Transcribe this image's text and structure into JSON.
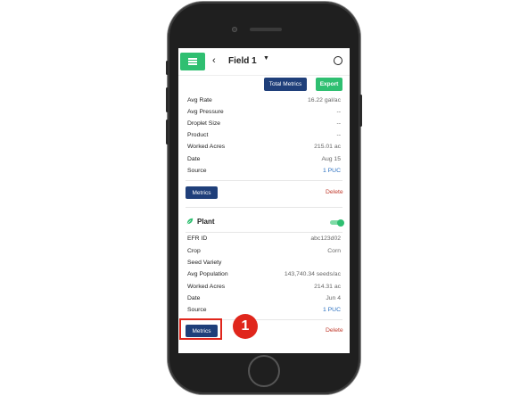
{
  "header": {
    "back_glyph": "‹",
    "field_title": "Field 1",
    "caret_glyph": "▼"
  },
  "toolbar": {
    "total_metrics_label": "Total Metrics",
    "export_label": "Export"
  },
  "first_record": {
    "rows": [
      {
        "label": "Avg Rate",
        "value": "16.22 gal/ac"
      },
      {
        "label": "Avg Pressure",
        "value": "--"
      },
      {
        "label": "Droplet Size",
        "value": "--"
      },
      {
        "label": "Product",
        "value": "--"
      },
      {
        "label": "Worked Acres",
        "value": "215.01 ac"
      },
      {
        "label": "Date",
        "value": "Aug 15"
      },
      {
        "label": "Source",
        "value": "1 PUC"
      }
    ],
    "metrics_label": "Metrics",
    "delete_label": "Delete"
  },
  "plant_record": {
    "title": "Plant",
    "toggle_on": true,
    "rows": [
      {
        "label": "EFR ID",
        "value": "abc123d02"
      },
      {
        "label": "Crop",
        "value": "Corn"
      },
      {
        "label": "Seed Variety",
        "value": ""
      },
      {
        "label": "Avg Population",
        "value": "143,740.34 seeds/ac"
      },
      {
        "label": "Worked Acres",
        "value": "214.31 ac"
      },
      {
        "label": "Date",
        "value": "Jun 4"
      },
      {
        "label": "Source",
        "value": "1 PUC"
      }
    ],
    "metrics_label": "Metrics",
    "delete_label": "Delete"
  },
  "annotation": {
    "step_number": "1"
  },
  "icons": {
    "menu": "hamburger-icon",
    "user": "user-circle-icon",
    "plant": "leaf-icon"
  },
  "colors": {
    "accent_green": "#2fbf71",
    "navy": "#1f3f7a",
    "delete_red": "#c0392b",
    "link_blue": "#2a6fc0",
    "annotation_red": "#e0261c"
  }
}
